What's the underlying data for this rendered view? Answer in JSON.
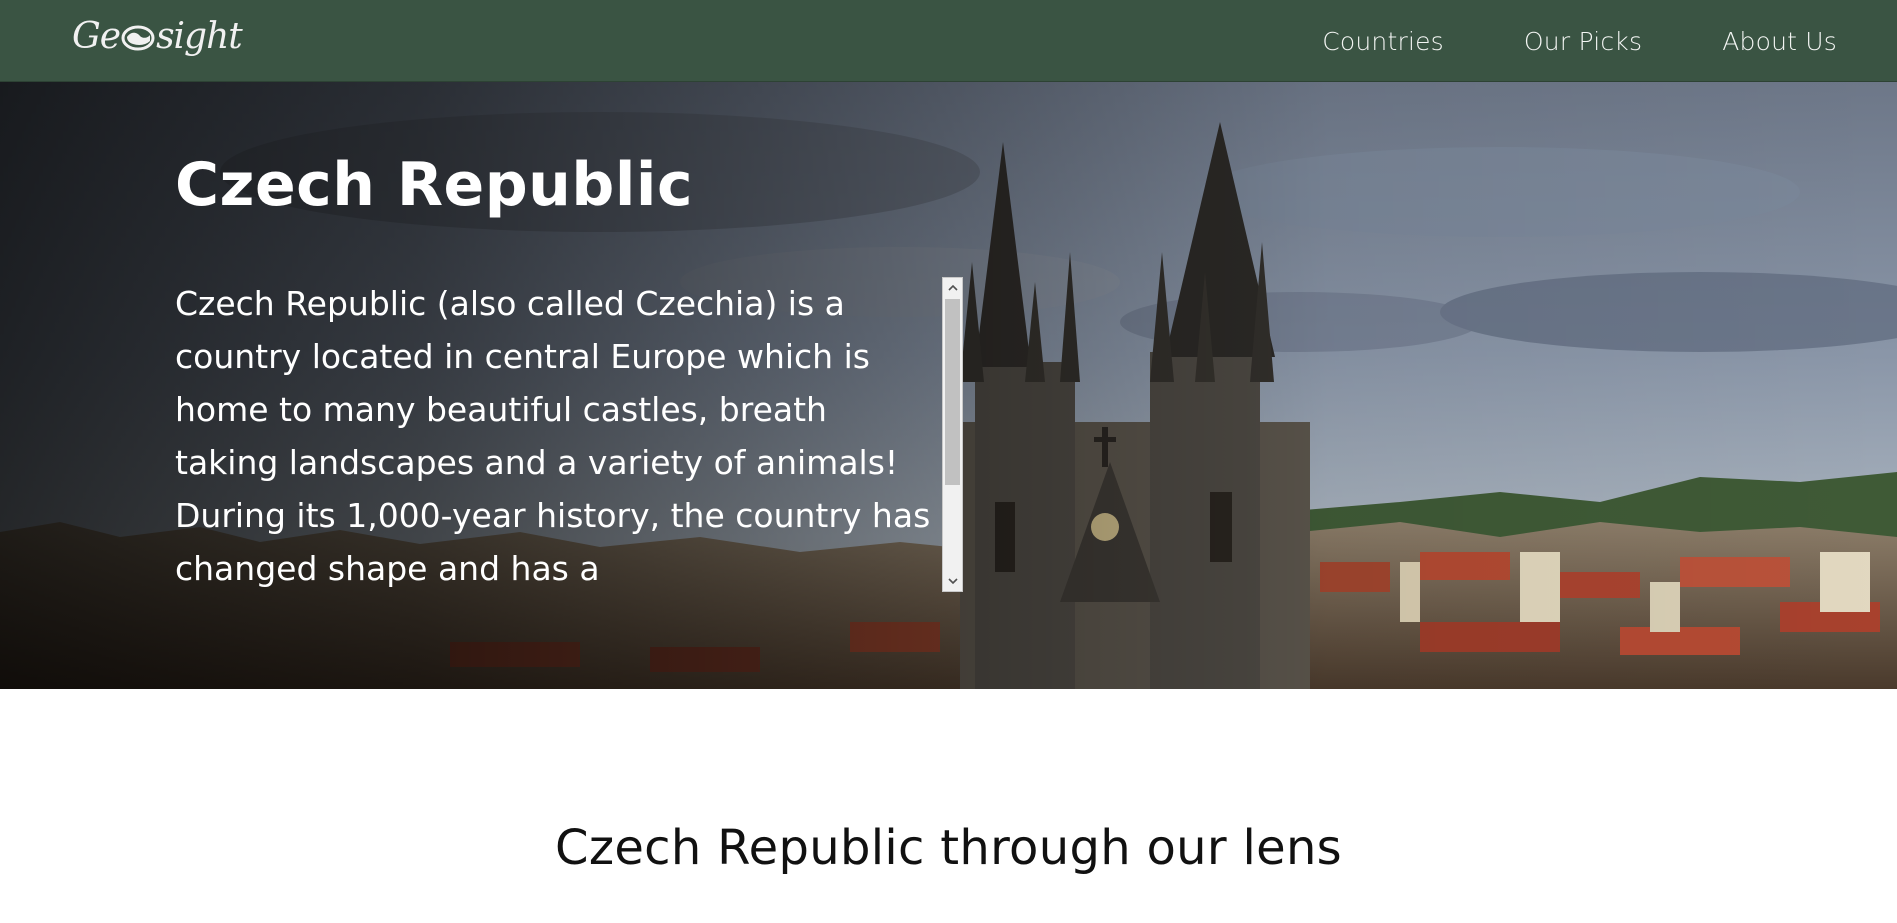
{
  "brand": {
    "logo_text_left": "Ge",
    "logo_text_right": "sight"
  },
  "nav": {
    "items": [
      {
        "label": "Countries"
      },
      {
        "label": "Our Picks"
      },
      {
        "label": "About Us"
      }
    ]
  },
  "hero": {
    "title": "Czech Republic",
    "description": "Czech Republic (also called Czechia) is a country located in central Europe which is home to many beautiful castles, breath taking landscapes and a variety of animals! During its 1,000-year history, the country has changed shape and has a"
  },
  "section": {
    "heading": "Czech Republic through our lens"
  },
  "colors": {
    "navbar": "#3a5443",
    "text_light": "#ffffff"
  }
}
